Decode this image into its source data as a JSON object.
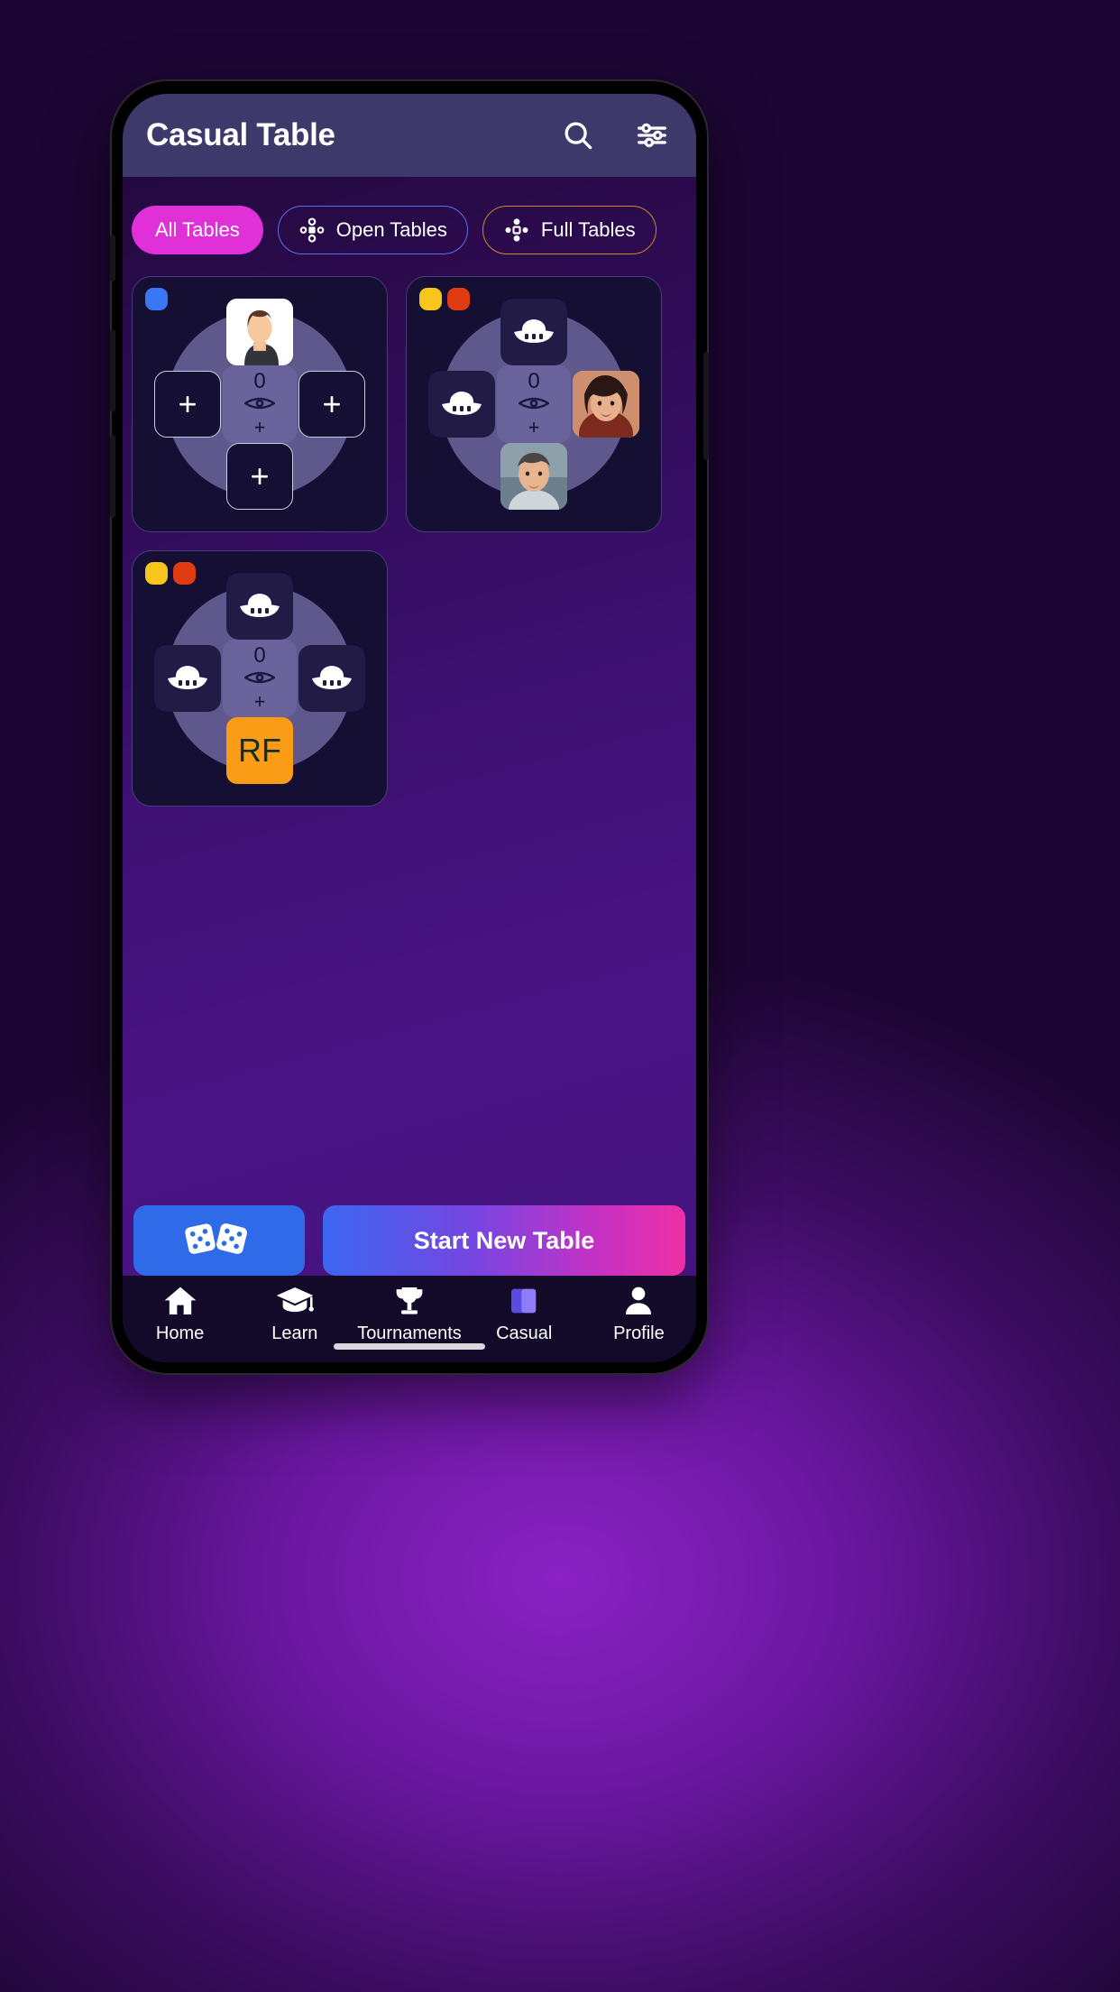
{
  "header": {
    "title": "Casual Table",
    "search_icon": "search-icon",
    "filter_icon": "sliders-filter-icon"
  },
  "tabs": [
    {
      "label": "All Tables",
      "icon": "none",
      "state": "active"
    },
    {
      "label": "Open Tables",
      "icon": "open-table-icon",
      "state": "outline-blue"
    },
    {
      "label": "Full Tables",
      "icon": "full-table-icon",
      "state": "outline-gold"
    }
  ],
  "tables": [
    {
      "name": "table-card-1",
      "status_dots": [
        "#3b77f5"
      ],
      "center": {
        "count": "0",
        "plus": "+",
        "eye_icon": "eye-icon"
      },
      "seats": [
        {
          "pos": "n",
          "type": "photo",
          "label": "",
          "avatar": "male-avatar"
        },
        {
          "pos": "w",
          "type": "empty",
          "label": "+"
        },
        {
          "pos": "e",
          "type": "empty",
          "label": "+"
        },
        {
          "pos": "s",
          "type": "empty",
          "label": "+"
        }
      ]
    },
    {
      "name": "table-card-2",
      "status_dots": [
        "#f8c51c",
        "#e03b12"
      ],
      "center": {
        "count": "0",
        "plus": "+",
        "eye_icon": "eye-icon"
      },
      "seats": [
        {
          "pos": "n",
          "type": "bot",
          "label": "",
          "avatar": "ufo-bot-icon"
        },
        {
          "pos": "w",
          "type": "bot",
          "label": "",
          "avatar": "ufo-bot-icon"
        },
        {
          "pos": "e",
          "type": "photo",
          "label": "",
          "avatar": "female-avatar"
        },
        {
          "pos": "s",
          "type": "photo",
          "label": "",
          "avatar": "male-avatar-2"
        }
      ]
    },
    {
      "name": "table-card-3",
      "status_dots": [
        "#f8c51c",
        "#e03b12"
      ],
      "center": {
        "count": "0",
        "plus": "+",
        "eye_icon": "eye-icon"
      },
      "seats": [
        {
          "pos": "n",
          "type": "bot",
          "label": "",
          "avatar": "ufo-bot-icon"
        },
        {
          "pos": "w",
          "type": "bot",
          "label": "",
          "avatar": "ufo-bot-icon"
        },
        {
          "pos": "e",
          "type": "bot",
          "label": "",
          "avatar": "ufo-bot-icon"
        },
        {
          "pos": "s",
          "type": "rf",
          "label": "RF"
        }
      ]
    }
  ],
  "actions": {
    "dice_label": "",
    "dice_icon": "two-dice-icon",
    "start_label": "Start New Table"
  },
  "bottom_nav": [
    {
      "label": "Home",
      "icon": "home-icon",
      "active": false
    },
    {
      "label": "Learn",
      "icon": "graduation-cap-icon",
      "active": false
    },
    {
      "label": "Tournaments",
      "icon": "trophy-icon",
      "active": false
    },
    {
      "label": "Casual",
      "icon": "cards-icon",
      "active": true
    },
    {
      "label": "Profile",
      "icon": "person-icon",
      "active": false
    }
  ],
  "colors": {
    "accent_pink": "#e030d8",
    "tab_blue": "#5b6fe8",
    "tab_gold": "#c98b2a",
    "orange_rf": "#fb9c16",
    "appbar": "#3d3a6b"
  }
}
